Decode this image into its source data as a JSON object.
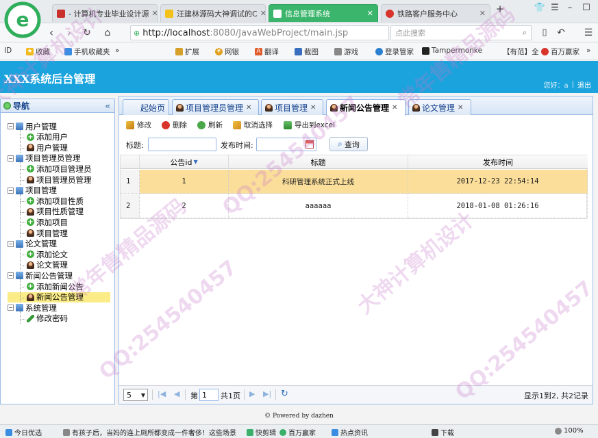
{
  "browser": {
    "tabs": [
      {
        "label": "- 计算机专业毕业设计源",
        "active": false
      },
      {
        "label": "汪建林源码大神调试的C",
        "active": false
      },
      {
        "label": "信息管理系统",
        "active": true
      },
      {
        "label": "铁路客户服务中心",
        "active": false
      }
    ],
    "new_tab": "+",
    "url_host": "http://localhost",
    "url_rest": ":8080/JavaWebProject/main.jsp",
    "search_placeholder": "点此搜索"
  },
  "bookmarks": [
    "收藏",
    "手机收藏夹",
    "»",
    "扩展",
    "网银",
    "翻译",
    "截图",
    "游戏",
    "登录管家",
    "Tampermonke",
    "【有范】全",
    "百万赢家",
    "»"
  ],
  "app": {
    "title": "XXX系统后台管理",
    "greeting": "您好：a",
    "separator": "|",
    "logout": "退出",
    "footer": "© Powered by dazhen"
  },
  "sidebar": {
    "title": "导航",
    "collapse": "«",
    "groups": [
      {
        "label": "用户管理",
        "items": [
          "添加用户",
          "用户管理"
        ]
      },
      {
        "label": "项目管理员管理",
        "items": [
          "添加项目管理员",
          "项目管理员管理"
        ]
      },
      {
        "label": "项目管理",
        "items": [
          "添加项目性质",
          "项目性质管理",
          "添加项目",
          "项目管理"
        ]
      },
      {
        "label": "论文管理",
        "items": [
          "添加论文",
          "论文管理"
        ]
      },
      {
        "label": "新闻公告管理",
        "items": [
          "添加新闻公告",
          "新闻公告管理"
        ]
      },
      {
        "label": "系统管理",
        "items": [
          "修改密码"
        ]
      }
    ]
  },
  "main_tabs": [
    "起始页",
    "项目管理员管理",
    "项目管理",
    "新闻公告管理",
    "论文管理"
  ],
  "toolbar": {
    "edit": "修改",
    "delete": "删除",
    "refresh": "刷新",
    "cancel_select": "取消选择",
    "export": "导出到excel"
  },
  "search": {
    "title_label": "标题:",
    "time_label": "发布时间:",
    "query": "查询"
  },
  "grid": {
    "headers": [
      "公告id",
      "标题",
      "发布时间"
    ],
    "rows": [
      {
        "num": "1",
        "id": "1",
        "title": "科研管理系统正式上线",
        "time": "2017-12-23 22:54:14"
      },
      {
        "num": "2",
        "id": "2",
        "title": "aaaaaa",
        "time": "2018-01-08 01:26:16"
      }
    ]
  },
  "pager": {
    "page_size": "5",
    "page_prefix": "第",
    "page": "1",
    "page_suffix": "共1页",
    "summary": "显示1到2, 共2记录"
  },
  "statusbar": [
    "今日优选",
    "有孩子后，当妈的连上厕所都变成一件奢侈！这些场景",
    "快剪辑",
    "百万赢家",
    "热点资讯",
    "下载",
    "100%"
  ],
  "watermarks": [
    "QQ:254540457",
    "大神计算机设计",
    "常年售精品源码"
  ],
  "colors": {
    "header": "#1ba3dd",
    "active_tab": "#3bb56b",
    "row_highlight": "#fbde9a"
  }
}
